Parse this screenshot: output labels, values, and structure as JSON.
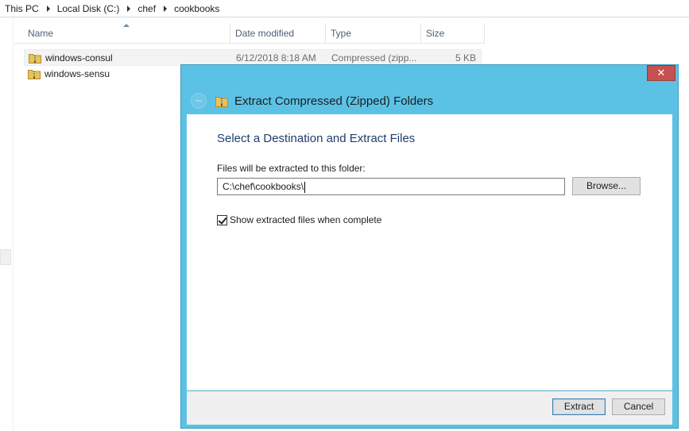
{
  "breadcrumb": {
    "items": [
      "This PC",
      "Local Disk (C:)",
      "chef",
      "cookbooks"
    ]
  },
  "file_list": {
    "columns": {
      "name": "Name",
      "date": "Date modified",
      "type": "Type",
      "size": "Size"
    },
    "rows": [
      {
        "name": "windows-consul",
        "date": "6/12/2018 8:18 AM",
        "type": "Compressed (zipp...",
        "size": "5 KB"
      },
      {
        "name": "windows-sensu",
        "date": "",
        "type": "",
        "size": ""
      }
    ]
  },
  "dialog": {
    "title": "Extract Compressed (Zipped) Folders",
    "close_label": "✕",
    "heading": "Select a Destination and Extract Files",
    "field_label": "Files will be extracted to this folder:",
    "path_value": "C:\\chef\\cookbooks\\",
    "browse_label": "Browse...",
    "checkbox_label": "Show extracted files when complete",
    "checkbox_checked": true,
    "extract_label": "Extract",
    "cancel_label": "Cancel"
  },
  "colors": {
    "dialog_frame": "#5bc2e6",
    "close_button": "#c75050",
    "heading_text": "#1e3e6e"
  },
  "icons": {
    "folder_zip": "zip-folder-icon",
    "back": "back-arrow-icon",
    "close": "close-icon"
  }
}
